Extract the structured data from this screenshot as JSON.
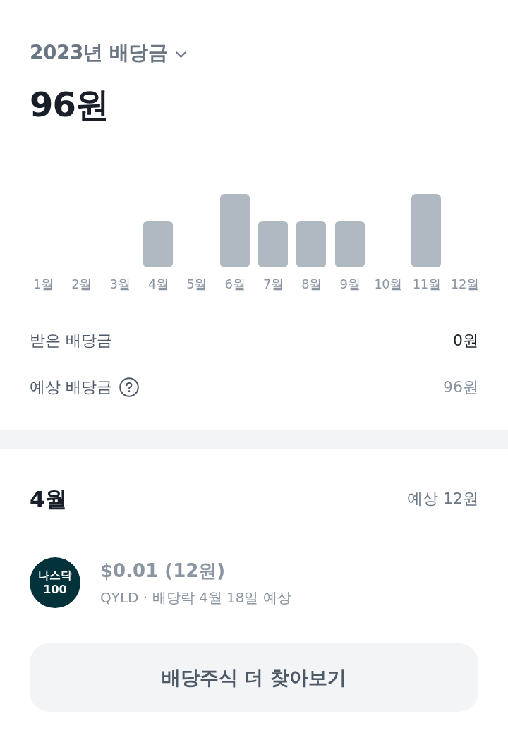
{
  "header": {
    "title": "2023년 배당금",
    "total": "96원"
  },
  "chart": {
    "months": [
      "1월",
      "2월",
      "3월",
      "4월",
      "5월",
      "6월",
      "7월",
      "8월",
      "9월",
      "10월",
      "11월",
      "12월"
    ]
  },
  "summary": [
    {
      "kind": "received",
      "label": "받은 배당금",
      "value": "0원",
      "help": false
    },
    {
      "kind": "expected",
      "label": "예상 배당금",
      "value": "96원",
      "help": true
    }
  ],
  "month_section": {
    "title": "4월",
    "expected": "예상 12원",
    "items": [
      {
        "logo": [
          "나스닥",
          "100"
        ],
        "amount": "$0.01 (12원)",
        "detail": "QYLD · 배당락 4월 18일 예상"
      }
    ]
  },
  "button": {
    "label": "배당주식 더 찾아보기"
  }
}
